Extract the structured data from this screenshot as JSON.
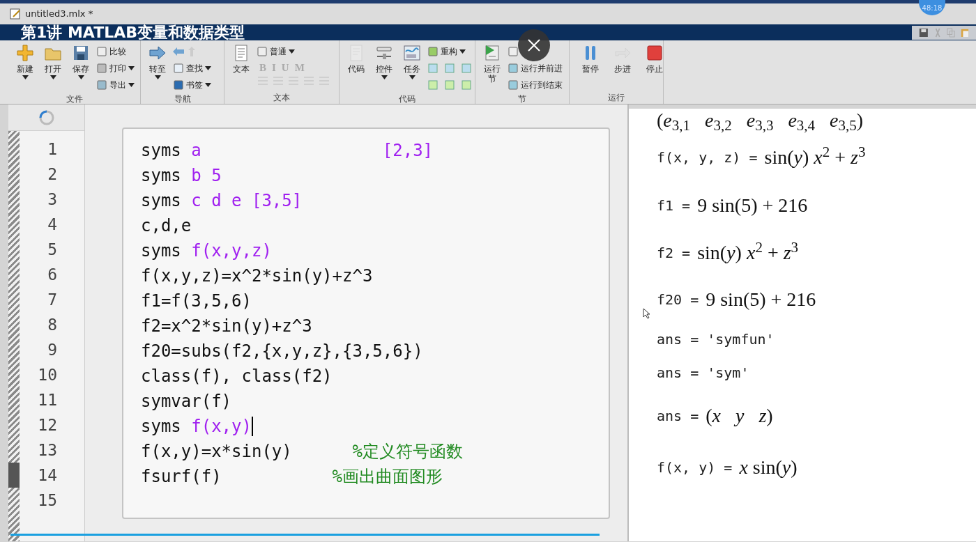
{
  "window": {
    "title": "untitled3.mlx *"
  },
  "video_overlay": {
    "caption": "第1讲 MATLAB变量和数据类型",
    "timer": "48:18"
  },
  "toolstrip": {
    "groups": [
      {
        "label": "文件",
        "large": [
          {
            "label": "新建",
            "dropdown": true,
            "disabled": false
          },
          {
            "label": "打开",
            "dropdown": true,
            "disabled": false
          },
          {
            "label": "保存",
            "dropdown": true,
            "disabled": false
          }
        ],
        "small": [
          {
            "label": "比较",
            "dropdown": false
          },
          {
            "label": "打印",
            "dropdown": true
          },
          {
            "label": "导出",
            "dropdown": true
          }
        ]
      },
      {
        "label": "导航",
        "large": [
          {
            "label": "转至",
            "dropdown": true,
            "disabled": false
          }
        ],
        "small": [
          {
            "label": "查找",
            "dropdown": true
          },
          {
            "label": "书签",
            "dropdown": true
          }
        ]
      },
      {
        "label": "文本",
        "large": [
          {
            "label": "文本",
            "dropdown": false,
            "disabled": false
          }
        ],
        "small": [
          {
            "label": "普通",
            "dropdown": true
          }
        ],
        "format_keys": [
          "B",
          "I",
          "U",
          "M"
        ]
      },
      {
        "label": "代码",
        "large": [
          {
            "label": "代码",
            "dropdown": false,
            "disabled": true
          },
          {
            "label": "控件",
            "dropdown": true,
            "disabled": false
          },
          {
            "label": "任务",
            "dropdown": true,
            "disabled": false
          }
        ],
        "small": [
          {
            "label": "重构",
            "dropdown": true
          }
        ]
      },
      {
        "label": "节",
        "large": [
          {
            "label": "运行节",
            "dropdown": false,
            "disabled": false
          }
        ],
        "small": [
          {
            "label": "运行并前进",
            "dropdown": false
          },
          {
            "label": "运行到结束",
            "dropdown": false
          }
        ]
      },
      {
        "label": "运行",
        "large": [
          {
            "label": "暂停",
            "dropdown": false,
            "disabled": false
          },
          {
            "label": "步进",
            "dropdown": false,
            "disabled": true
          },
          {
            "label": "停止",
            "dropdown": false,
            "disabled": false
          }
        ]
      }
    ]
  },
  "editor": {
    "lines": [
      {
        "number": "1",
        "marked": false,
        "cursor": false,
        "segments": [
          {
            "text": "syms ",
            "kind": "plain"
          },
          {
            "text": "a                  [2,3]",
            "kind": "symbol"
          }
        ]
      },
      {
        "number": "2",
        "marked": false,
        "cursor": false,
        "segments": [
          {
            "text": "syms ",
            "kind": "plain"
          },
          {
            "text": "b 5",
            "kind": "symbol"
          }
        ]
      },
      {
        "number": "3",
        "marked": false,
        "cursor": false,
        "segments": [
          {
            "text": "syms ",
            "kind": "plain"
          },
          {
            "text": "c d e [3,5]",
            "kind": "symbol"
          }
        ]
      },
      {
        "number": "4",
        "marked": false,
        "cursor": false,
        "segments": [
          {
            "text": "c,d,e",
            "kind": "plain"
          }
        ]
      },
      {
        "number": "5",
        "marked": false,
        "cursor": false,
        "segments": [
          {
            "text": "syms ",
            "kind": "plain"
          },
          {
            "text": "f(x,y,z)",
            "kind": "symbol"
          }
        ]
      },
      {
        "number": "6",
        "marked": false,
        "cursor": false,
        "segments": [
          {
            "text": "f(x,y,z)=x^2*sin(y)+z^3",
            "kind": "plain"
          }
        ]
      },
      {
        "number": "7",
        "marked": false,
        "cursor": false,
        "segments": [
          {
            "text": "f1=f(3,5,6)",
            "kind": "plain"
          }
        ]
      },
      {
        "number": "8",
        "marked": false,
        "cursor": false,
        "segments": [
          {
            "text": "f2=x^2*sin(y)+z^3",
            "kind": "plain"
          }
        ]
      },
      {
        "number": "9",
        "marked": false,
        "cursor": false,
        "segments": [
          {
            "text": "f20=subs(f2,{x,y,z},{3,5,6})",
            "kind": "plain"
          }
        ]
      },
      {
        "number": "10",
        "marked": false,
        "cursor": false,
        "segments": [
          {
            "text": "class(f), class(f2)",
            "kind": "plain"
          }
        ]
      },
      {
        "number": "11",
        "marked": false,
        "cursor": false,
        "segments": [
          {
            "text": "symvar(f)",
            "kind": "plain"
          }
        ]
      },
      {
        "number": "12",
        "marked": false,
        "cursor": true,
        "segments": [
          {
            "text": "syms ",
            "kind": "plain"
          },
          {
            "text": "f(x,y)",
            "kind": "symbol"
          }
        ]
      },
      {
        "number": "13",
        "marked": false,
        "cursor": false,
        "segments": [
          {
            "text": "f(x,y)=x*sin(y)      ",
            "kind": "plain"
          },
          {
            "text": "%定义符号函数",
            "kind": "comment"
          }
        ]
      },
      {
        "number": "14",
        "marked": true,
        "cursor": false,
        "segments": [
          {
            "text": "fsurf(f)           ",
            "kind": "plain"
          },
          {
            "text": "%画出曲面图形",
            "kind": "comment"
          }
        ]
      },
      {
        "number": "15",
        "marked": false,
        "cursor": false
      }
    ]
  },
  "output": [
    {
      "kind": "math",
      "math": "(*e*$_{3,1}$   *e*$_{3,2}$   *e*$_{3,3}$   *e*$_{3,4}$   *e*$_{3,5}$)"
    },
    {
      "kind": "math",
      "label": "f(x, y, z) =",
      "math": "sin(*y*) *x*$^{2}$ + *z*$^{3}$"
    },
    {
      "kind": "math",
      "label": "f1 =",
      "math": "9 sin(5) + 216"
    },
    {
      "kind": "math",
      "label": "f2 =",
      "math": "sin(*y*) *x*$^{2}$ + *z*$^{3}$"
    },
    {
      "kind": "math",
      "label": "f20 =",
      "math": "9 sin(5) + 216"
    },
    {
      "kind": "text",
      "label": "ans = 'symfun'"
    },
    {
      "kind": "text",
      "label": "ans = 'sym'"
    },
    {
      "kind": "math",
      "label": "ans =",
      "math": "(*x*   *y*   *z*)"
    },
    {
      "kind": "math",
      "label": "f(x, y) =",
      "math": "*x* sin(*y*)"
    }
  ]
}
